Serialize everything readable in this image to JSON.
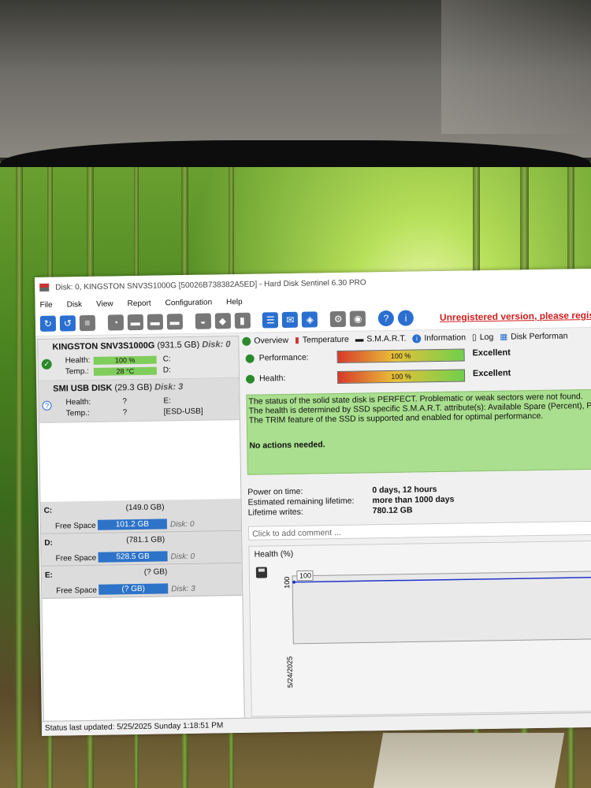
{
  "window": {
    "title": "Disk: 0, KINGSTON SNV3S1000G [50026B738382A5ED]  -  Hard Disk Sentinel 6.30 PRO",
    "unregistered": "Unregistered version, please registe"
  },
  "menu": [
    "File",
    "Disk",
    "View",
    "Report",
    "Configuration",
    "Help"
  ],
  "disks": [
    {
      "name": "KINGSTON SNV3S1000G",
      "size": "(931.5 GB)",
      "disk": "Disk: 0",
      "health_label": "Health:",
      "health": "100 %",
      "health_pct": 100,
      "temp_label": "Temp.:",
      "temp": "28 °C",
      "drives": [
        "C:",
        "D:"
      ],
      "status": "ok"
    },
    {
      "name": "SMI    USB DISK",
      "size": "(29.3 GB)",
      "disk": "Disk: 3",
      "health_label": "Health:",
      "health": "?",
      "temp_label": "Temp.:",
      "temp": "?",
      "drives": [
        "E:",
        "[ESD-USB]"
      ],
      "status": "unknown"
    }
  ],
  "drives": [
    {
      "letter": "C:",
      "total": "(149.0 GB)",
      "free_label": "Free Space",
      "free": "101.2 GB",
      "disk": "Disk: 0"
    },
    {
      "letter": "D:",
      "total": "(781.1 GB)",
      "free_label": "Free Space",
      "free": "528.5 GB",
      "disk": "Disk: 0"
    },
    {
      "letter": "E:",
      "total": "(? GB)",
      "free_label": "Free Space",
      "free": "(? GB)",
      "disk": "Disk: 3"
    }
  ],
  "tabs": [
    "Overview",
    "Temperature",
    "S.M.A.R.T.",
    "Information",
    "Log",
    "Disk Performan"
  ],
  "overview": {
    "performance_label": "Performance:",
    "performance": "100 %",
    "performance_verdict": "Excellent",
    "health_label": "Health:",
    "health": "100 %",
    "health_verdict": "Excellent",
    "message_lines": [
      "The status of the solid state disk is PERFECT. Problematic or weak sectors were not found.",
      "The health is determined by SSD specific S.M.A.R.T. attribute(s):  Available Spare (Percent), Pe",
      "The TRIM feature of the SSD is supported and enabled for optimal performance."
    ],
    "no_actions": "No actions needed.",
    "stats": [
      {
        "label": "Power on time:",
        "value": "0 days, 12 hours"
      },
      {
        "label": "Estimated remaining lifetime:",
        "value": "more than 1000 days"
      },
      {
        "label": "Lifetime writes:",
        "value": "780.12 GB"
      }
    ],
    "comment_placeholder": "Click to add comment ..."
  },
  "chart_data": {
    "type": "line",
    "title": "Health (%)",
    "x": [
      "5/24/2025"
    ],
    "series": [
      {
        "values": [
          100
        ]
      }
    ],
    "ytick": "100",
    "data_label": "100"
  },
  "statusbar": "Status last updated: 5/25/2025 Sunday 1:18:51 PM",
  "colors": {
    "accent": "#2d73c8",
    "good": "#2b8a2b",
    "warning_text": "#d21e1e",
    "message_bg": "#a9df8e"
  }
}
